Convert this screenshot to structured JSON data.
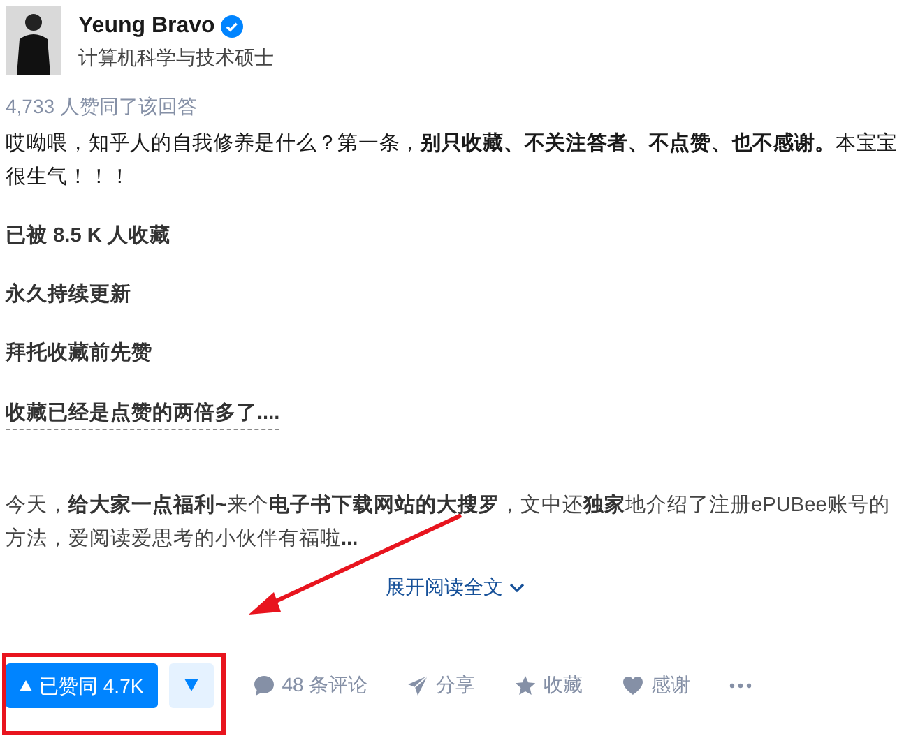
{
  "author": {
    "name": "Yeung Bravo",
    "verified": true,
    "headline": "计算机科学与技术硕士"
  },
  "vote_summary": "4,733 人赞同了该回答",
  "content": [
    {
      "kind": "text",
      "text": "哎呦喂，知乎人的自我修养是什么？第一条，**别只收藏、不关注答者、不点赞、也不感谢。**本宝宝很生气！！！"
    },
    {
      "kind": "bold",
      "text": "已被 8.5 K 人收藏"
    },
    {
      "kind": "bold",
      "text": "永久持续更新"
    },
    {
      "kind": "bold",
      "text": "拜托收藏前先赞"
    },
    {
      "kind": "underlined",
      "text": "收藏已经是点赞的两倍多了...."
    },
    {
      "kind": "faded",
      "text": "今天，**给大家一点福利~**来个**电子书下载网站的大搜罗**，文中还**独家**地介绍了注册ePUBee账号的方法，爱阅读爱思考的小伙伴有福啦**...**"
    }
  ],
  "expand": {
    "label": "展开阅读全文"
  },
  "actions": {
    "upvote": {
      "label": "已赞同 4.7K",
      "selected": true
    },
    "buttons": [
      {
        "kind": "comment",
        "label": "48 条评论"
      },
      {
        "kind": "share",
        "label": "分享"
      },
      {
        "kind": "collect",
        "label": "收藏"
      },
      {
        "kind": "thanks",
        "label": "感谢"
      },
      {
        "kind": "more"
      }
    ]
  },
  "annotations": {
    "arrow": true,
    "box": true
  }
}
